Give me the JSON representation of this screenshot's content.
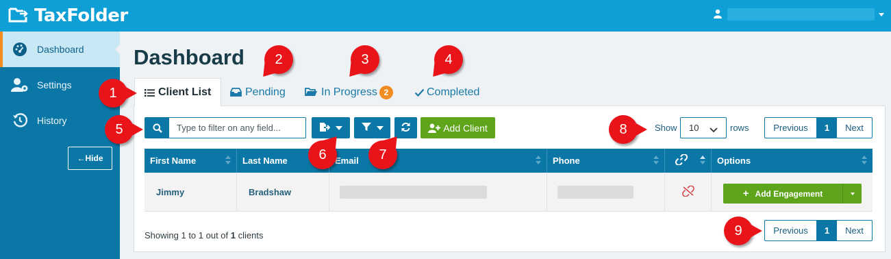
{
  "app": {
    "brand": "TaxFolder",
    "brand_color": "#0e9fd6",
    "sidebar_color": "#0b77a7",
    "accent_green": "#5fa51b",
    "accent_orange": "#f28b21",
    "user_icon": "user-icon"
  },
  "sidebar": {
    "items": [
      {
        "label": "Dashboard",
        "icon": "gauge-icon",
        "active": true
      },
      {
        "label": "Settings",
        "icon": "user-gear-icon",
        "active": false
      },
      {
        "label": "History",
        "icon": "history-icon",
        "active": false
      }
    ],
    "hide_label": "←Hide"
  },
  "main": {
    "title": "Dashboard",
    "tabs": [
      {
        "label": "Client List",
        "icon": "list-icon",
        "active": true
      },
      {
        "label": "Pending",
        "icon": "inbox-icon"
      },
      {
        "label": "In Progress",
        "icon": "folder-open-icon",
        "badge": "2"
      },
      {
        "label": "Completed",
        "icon": "check-icon"
      }
    ]
  },
  "toolbar": {
    "search_placeholder": "Type to filter on any field...",
    "search_value": "",
    "export_icon": "export-icon",
    "filter_icon": "filter-icon",
    "refresh_icon": "refresh-icon",
    "add_client_label": "Add Client",
    "show_label": "Show",
    "rows_value": "10",
    "rows_label": "rows"
  },
  "pagination": {
    "previous": "Previous",
    "page": "1",
    "next": "Next"
  },
  "table": {
    "columns": [
      "First Name",
      "Last Name",
      "Email",
      "Phone",
      "",
      "Options"
    ],
    "rows": [
      {
        "first_name": "Jimmy",
        "last_name": "Bradshaw",
        "email": "",
        "phone": "",
        "link_status": "unlinked-icon",
        "action_label": "Add Engagement"
      }
    ]
  },
  "footer": {
    "showing_prefix": "Showing 1 to 1 out of ",
    "showing_count": "1",
    "showing_suffix": " clients"
  },
  "callouts": [
    "1",
    "2",
    "3",
    "4",
    "5",
    "6",
    "7",
    "8",
    "9"
  ]
}
